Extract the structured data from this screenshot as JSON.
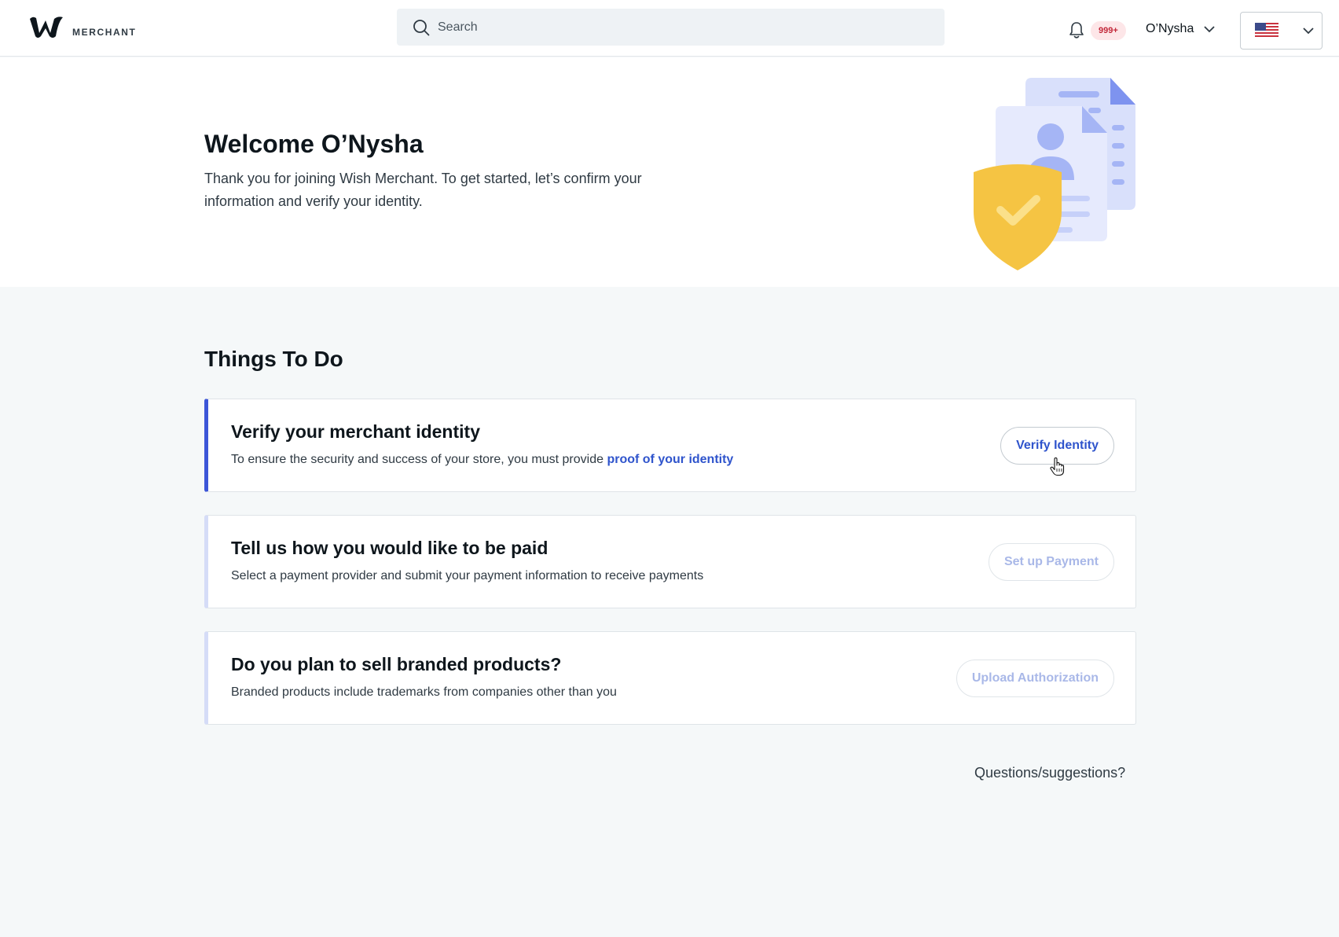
{
  "header": {
    "logo_text": "MERCHANT",
    "search_placeholder": "Search",
    "notification_count": "999+",
    "user_name": "O’Nysha",
    "locale_flag": "us-flag-icon"
  },
  "welcome": {
    "title": "Welcome O’Nysha",
    "body": "Thank you for joining Wish Merchant. To get started, let’s confirm your information and verify your identity."
  },
  "todo": {
    "title": "Things To Do",
    "items": [
      {
        "title": "Verify your merchant identity",
        "description": "To ensure the security and success of your store, you must provide ",
        "link_text": "proof of your identity",
        "button": "Verify Identity",
        "active": true
      },
      {
        "title": "Tell us how you would like to be paid",
        "description": "Select a payment provider and submit your payment information to receive payments",
        "button": "Set up Payment",
        "active": false
      },
      {
        "title": "Do you plan to sell branded products?",
        "description": "Branded products include trademarks from companies other than you",
        "button": "Upload Authorization",
        "active": false
      }
    ]
  },
  "footer": {
    "questions": "Questions/suggestions?"
  },
  "colors": {
    "accent": "#3c56d8",
    "link": "#2f54cc",
    "badge_bg": "#fde6e8",
    "badge_text": "#c2283a",
    "shield": "#f5c443"
  }
}
